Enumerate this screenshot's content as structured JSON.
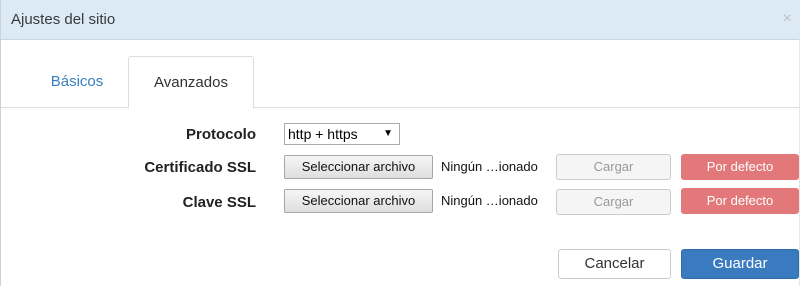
{
  "dialog": {
    "title": "Ajustes del sitio",
    "close_glyph": "×"
  },
  "tabs": [
    {
      "label": "Básicos",
      "active": false
    },
    {
      "label": "Avanzados",
      "active": true
    }
  ],
  "form": {
    "protocol": {
      "label": "Protocolo",
      "selected": "http + https",
      "arrow_glyph": "▼"
    },
    "ssl_certificate": {
      "label": "Certificado SSL",
      "file_button": "Seleccionar archivo",
      "file_name": "Ningún …ionado",
      "upload_button": "Cargar",
      "default_button": "Por defecto"
    },
    "ssl_key": {
      "label": "Clave SSL",
      "file_button": "Seleccionar archivo",
      "file_name": "Ningún …ionado",
      "upload_button": "Cargar",
      "default_button": "Por defecto"
    }
  },
  "footer": {
    "cancel_label": "Cancelar",
    "save_label": "Guardar"
  },
  "colors": {
    "titlebar_bg": "#dbeaf5",
    "link_blue": "#3a7fc1",
    "danger": "#e2787a",
    "primary": "#3a7bc0"
  }
}
